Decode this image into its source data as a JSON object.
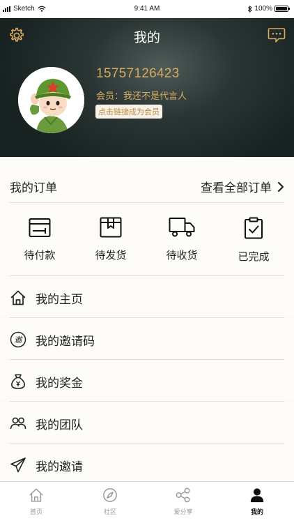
{
  "status_bar": {
    "carrier": "Sketch",
    "time": "9:41 AM",
    "battery": "100%"
  },
  "header": {
    "title": "我的"
  },
  "profile": {
    "phone": "15757126423",
    "member_status": "会员：我还不是代言人",
    "become_member_link": "点击链接成为会员"
  },
  "orders": {
    "title": "我的订单",
    "view_all": "查看全部订单",
    "states": [
      {
        "label": "待付款",
        "icon": "wallet-icon"
      },
      {
        "label": "待发货",
        "icon": "package-icon"
      },
      {
        "label": "待收货",
        "icon": "truck-icon"
      },
      {
        "label": "已完成",
        "icon": "clipboard-check-icon"
      }
    ]
  },
  "menu": [
    {
      "label": "我的主页",
      "icon": "home-icon"
    },
    {
      "label": "我的邀请码",
      "icon": "invite-code-icon",
      "icon_char": "邀"
    },
    {
      "label": "我的奖金",
      "icon": "money-bag-icon"
    },
    {
      "label": "我的团队",
      "icon": "team-icon"
    },
    {
      "label": "我的邀请",
      "icon": "paper-plane-icon"
    }
  ],
  "tabs": [
    {
      "label": "首页",
      "icon": "home-icon",
      "active": false
    },
    {
      "label": "社区",
      "icon": "compass-icon",
      "active": false
    },
    {
      "label": "爱分享",
      "icon": "share-icon",
      "active": false
    },
    {
      "label": "我的",
      "icon": "user-icon",
      "active": true
    }
  ],
  "colors": {
    "accent_gold": "#d8aa5f",
    "header_bg": "#1c2726",
    "page_bg": "#faf8f3"
  }
}
